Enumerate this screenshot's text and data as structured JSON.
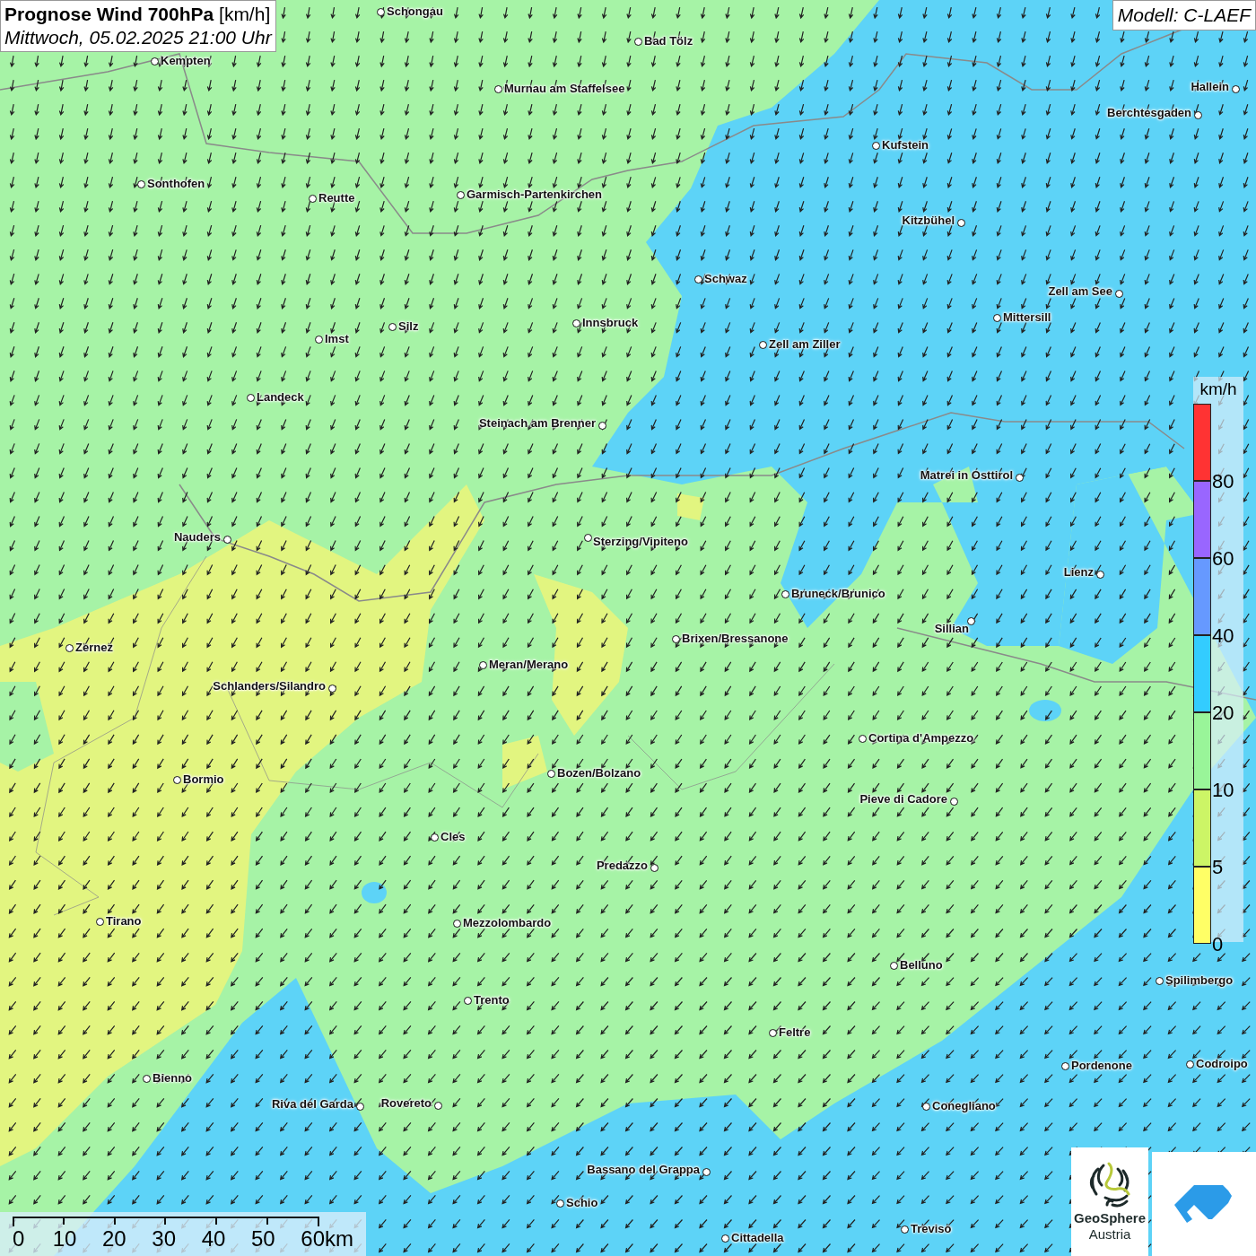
{
  "title": {
    "text": "Prognose Wind 700hPa",
    "unit": "[km/h]",
    "datetime": "Mittwoch, 05.02.2025 21:00 Uhr"
  },
  "model": "Modell: C-LAEF",
  "cities": [
    {
      "name": "Schongau",
      "faded": false
    },
    {
      "name": "Bad Tölz",
      "faded": false
    },
    {
      "name": "Kempten",
      "faded": false
    },
    {
      "name": "Murnau am Staffelsee",
      "faded": false
    },
    {
      "name": "Hallein",
      "faded": false
    },
    {
      "name": "Berchtesgaden",
      "faded": false
    },
    {
      "name": "Kufstein",
      "faded": false
    },
    {
      "name": "Sonthofen",
      "faded": false
    },
    {
      "name": "Reutte",
      "faded": false
    },
    {
      "name": "Garmisch-Partenkirchen",
      "faded": false
    },
    {
      "name": "Kitzbühel",
      "faded": false
    },
    {
      "name": "Schwaz",
      "faded": false
    },
    {
      "name": "Zell am See",
      "faded": false
    },
    {
      "name": "Innsbruck",
      "faded": false
    },
    {
      "name": "Mittersill",
      "faded": false
    },
    {
      "name": "Silz",
      "faded": false
    },
    {
      "name": "Imst",
      "faded": false
    },
    {
      "name": "Zell am Ziller",
      "faded": false
    },
    {
      "name": "Landeck",
      "faded": false
    },
    {
      "name": "Steinach am Brenner",
      "faded": false
    },
    {
      "name": "Matrei in Osttirol",
      "faded": false
    },
    {
      "name": "Nauders",
      "faded": false
    },
    {
      "name": "Sterzing/Vipiteno",
      "faded": false
    },
    {
      "name": "Lienz",
      "faded": false
    },
    {
      "name": "Bruneck/Brunico",
      "faded": false
    },
    {
      "name": "Sillian",
      "faded": false
    },
    {
      "name": "Brixen/Bressanone",
      "faded": false
    },
    {
      "name": "Zernez",
      "faded": false
    },
    {
      "name": "Meran/Merano",
      "faded": false
    },
    {
      "name": "Schlanders/Silandro",
      "faded": false
    },
    {
      "name": "Cortina d'Ampezzo",
      "faded": false
    },
    {
      "name": "Bozen/Bolzano",
      "faded": false
    },
    {
      "name": "Bormio",
      "faded": false
    },
    {
      "name": "Pieve di Cadore",
      "faded": false
    },
    {
      "name": "Cles",
      "faded": false
    },
    {
      "name": "Predazzo",
      "faded": false
    },
    {
      "name": "Tirano",
      "faded": false
    },
    {
      "name": "Mezzolombardo",
      "faded": false
    },
    {
      "name": "Belluno",
      "faded": false
    },
    {
      "name": "Spilimbergo",
      "faded": false
    },
    {
      "name": "Trento",
      "faded": false
    },
    {
      "name": "Feltre",
      "faded": false
    },
    {
      "name": "Pordenone",
      "faded": false
    },
    {
      "name": "Codroipo",
      "faded": false
    },
    {
      "name": "Bienno",
      "faded": false
    },
    {
      "name": "Riva del Garda",
      "faded": false
    },
    {
      "name": "Rovereto",
      "faded": false
    },
    {
      "name": "Conegliano",
      "faded": false
    },
    {
      "name": "Bassano del Grappa",
      "faded": false
    },
    {
      "name": "Schio",
      "faded": false
    },
    {
      "name": "Treviso",
      "faded": false
    },
    {
      "name": "Cittadella",
      "faded": false
    }
  ],
  "legend": {
    "unit": "km/h",
    "bins": [
      {
        "label": "80",
        "color": "#ff3333"
      },
      {
        "label": "60",
        "color": "#9966ff"
      },
      {
        "label": "40",
        "color": "#6699ff"
      },
      {
        "label": "20",
        "color": "#33ccff"
      },
      {
        "label": "10",
        "color": "#99f599"
      },
      {
        "label": "5",
        "color": "#ccf566"
      },
      {
        "label": "0",
        "color": "#ffff66"
      }
    ]
  },
  "scale_bar": {
    "ticks": [
      "0",
      "10",
      "20",
      "30",
      "40",
      "50",
      "60km"
    ]
  },
  "logo": {
    "line_1": "GeoSphere",
    "line_2": "Austria"
  }
}
